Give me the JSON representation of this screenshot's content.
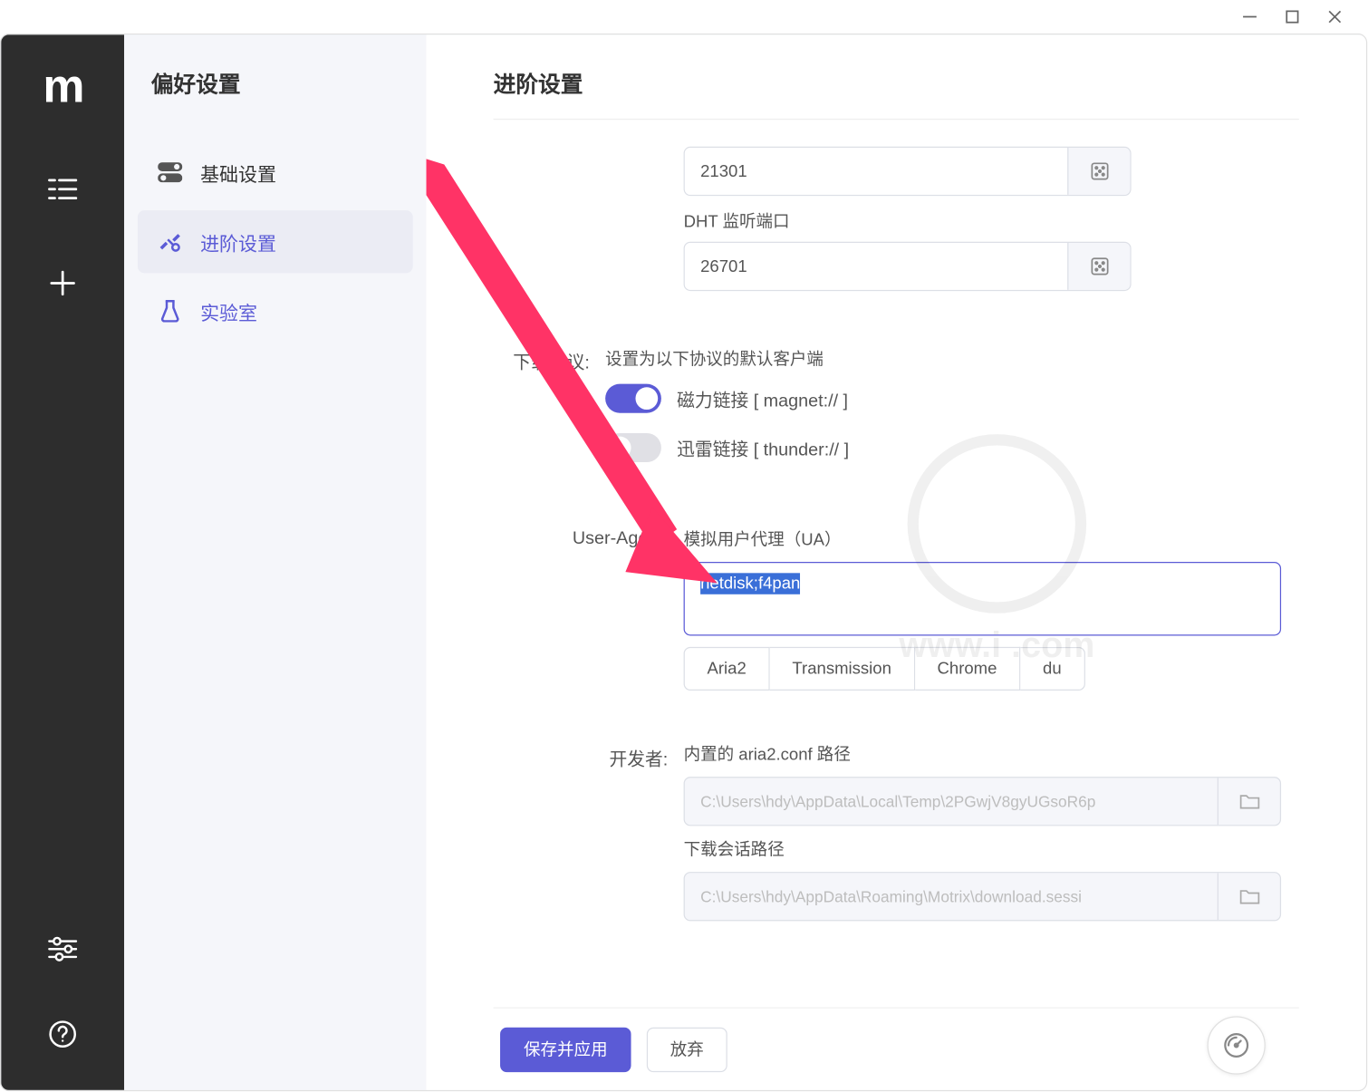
{
  "window": {
    "controls": {
      "min": "minimize",
      "max": "maximize",
      "close": "close"
    }
  },
  "rail": {
    "logo_text": "m"
  },
  "sidebar": {
    "title": "偏好设置",
    "items": [
      {
        "label": "基础设置",
        "active": false
      },
      {
        "label": "进阶设置",
        "active": true
      },
      {
        "label": "实验室",
        "active": false
      }
    ]
  },
  "content": {
    "title": "进阶设置",
    "port1_value": "21301",
    "dht_label": "DHT 监听端口",
    "dht_value": "26701",
    "protocol_label": "下载协议:",
    "protocol_desc": "设置为以下协议的默认客户端",
    "magnet_label": "磁力链接 [ magnet:// ]",
    "thunder_label": "迅雷链接 [ thunder:// ]",
    "ua_label": "User-Agent:",
    "ua_desc": "模拟用户代理（UA）",
    "ua_value": "netdisk;f4pan",
    "ua_presets": [
      "Aria2",
      "Transmission",
      "Chrome",
      "du"
    ],
    "dev_label": "开发者:",
    "aria2_conf_label": "内置的 aria2.conf 路径",
    "aria2_conf_value": "C:\\Users\\hdy\\AppData\\Local\\Temp\\2PGwjV8gyUGsoR6p",
    "session_label": "下载会话路径",
    "session_value": "C:\\Users\\hdy\\AppData\\Roaming\\Motrix\\download.sessi"
  },
  "footer": {
    "save": "保存并应用",
    "discard": "放弃"
  },
  "watermark_text": "www.i   .com"
}
